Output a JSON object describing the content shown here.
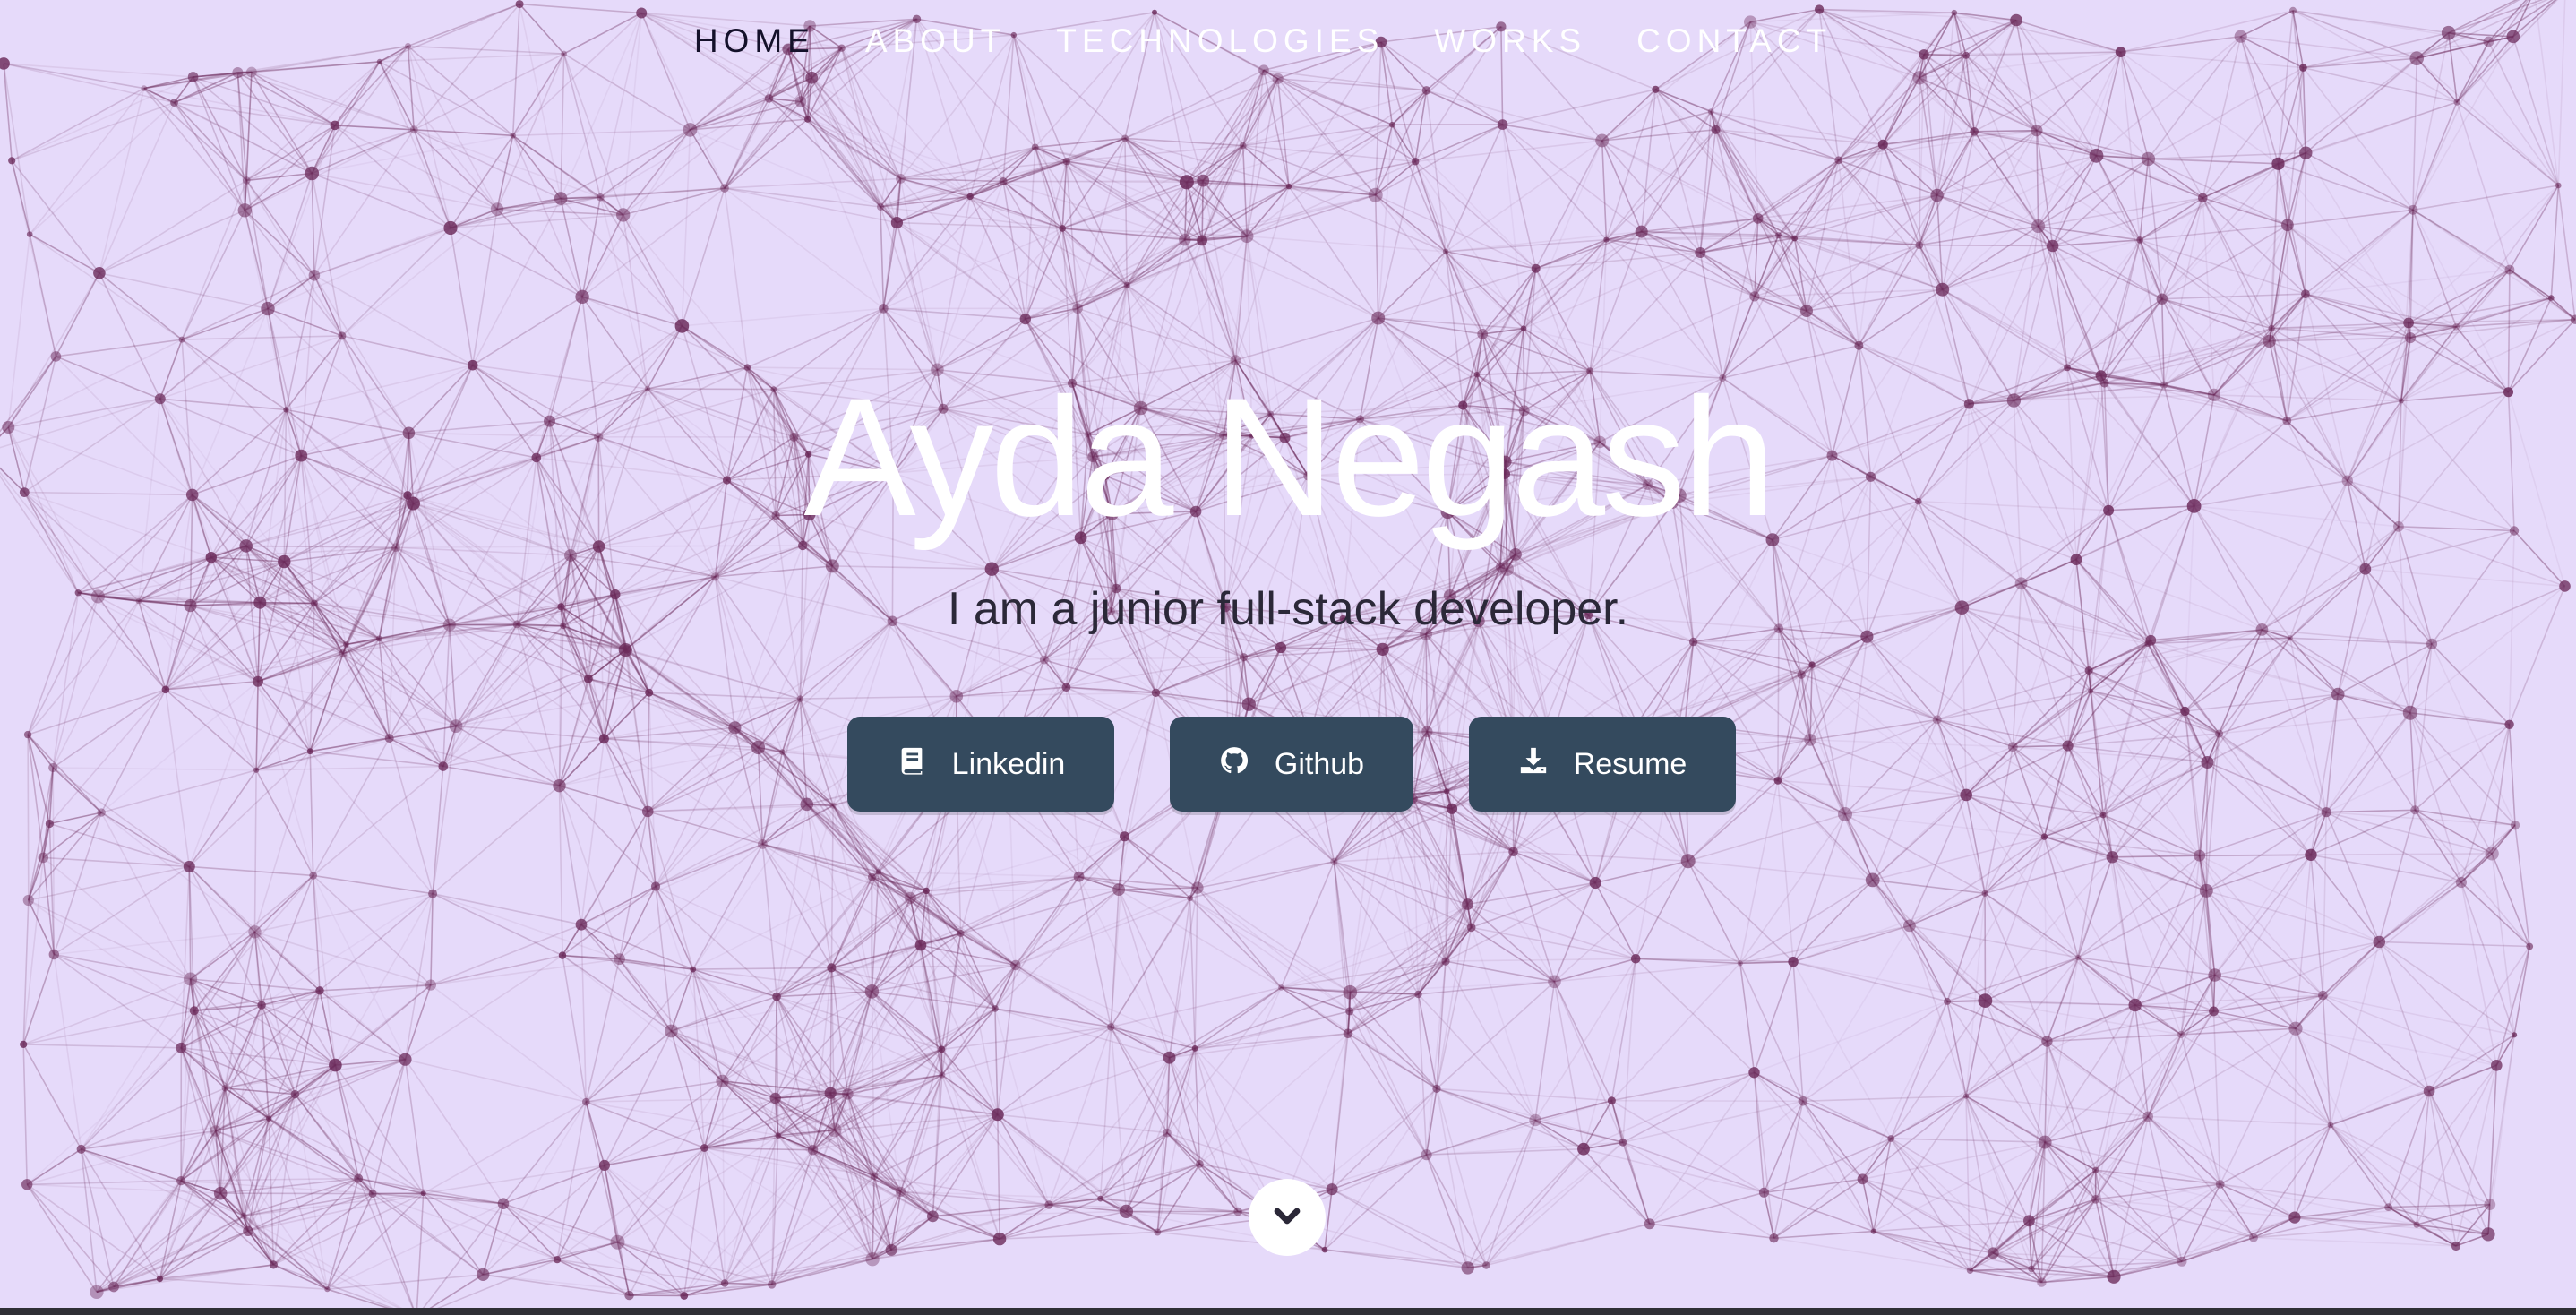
{
  "nav": {
    "items": [
      {
        "label": "HOME",
        "active": true
      },
      {
        "label": "ABOUT",
        "active": false
      },
      {
        "label": "TECHNOLOGIES",
        "active": false
      },
      {
        "label": "WORKS",
        "active": false
      },
      {
        "label": "CONTACT",
        "active": false
      }
    ]
  },
  "hero": {
    "title": "Ayda Negash",
    "subtitle": "I am a junior full-stack developer."
  },
  "actions": {
    "linkedin_label": "Linkedin",
    "github_label": "Github",
    "resume_label": "Resume"
  },
  "icons": {
    "linkedin": "book-icon",
    "github": "github-icon",
    "resume": "download-icon",
    "scroll": "chevron-down-icon"
  },
  "colors": {
    "background": "#e6dafa",
    "network_line": "#6b2a5a",
    "button": "#344a5e",
    "title": "#ffffff",
    "subtitle": "#2b2838",
    "nav_active": "#14112a",
    "nav_inactive": "#ffffff"
  }
}
